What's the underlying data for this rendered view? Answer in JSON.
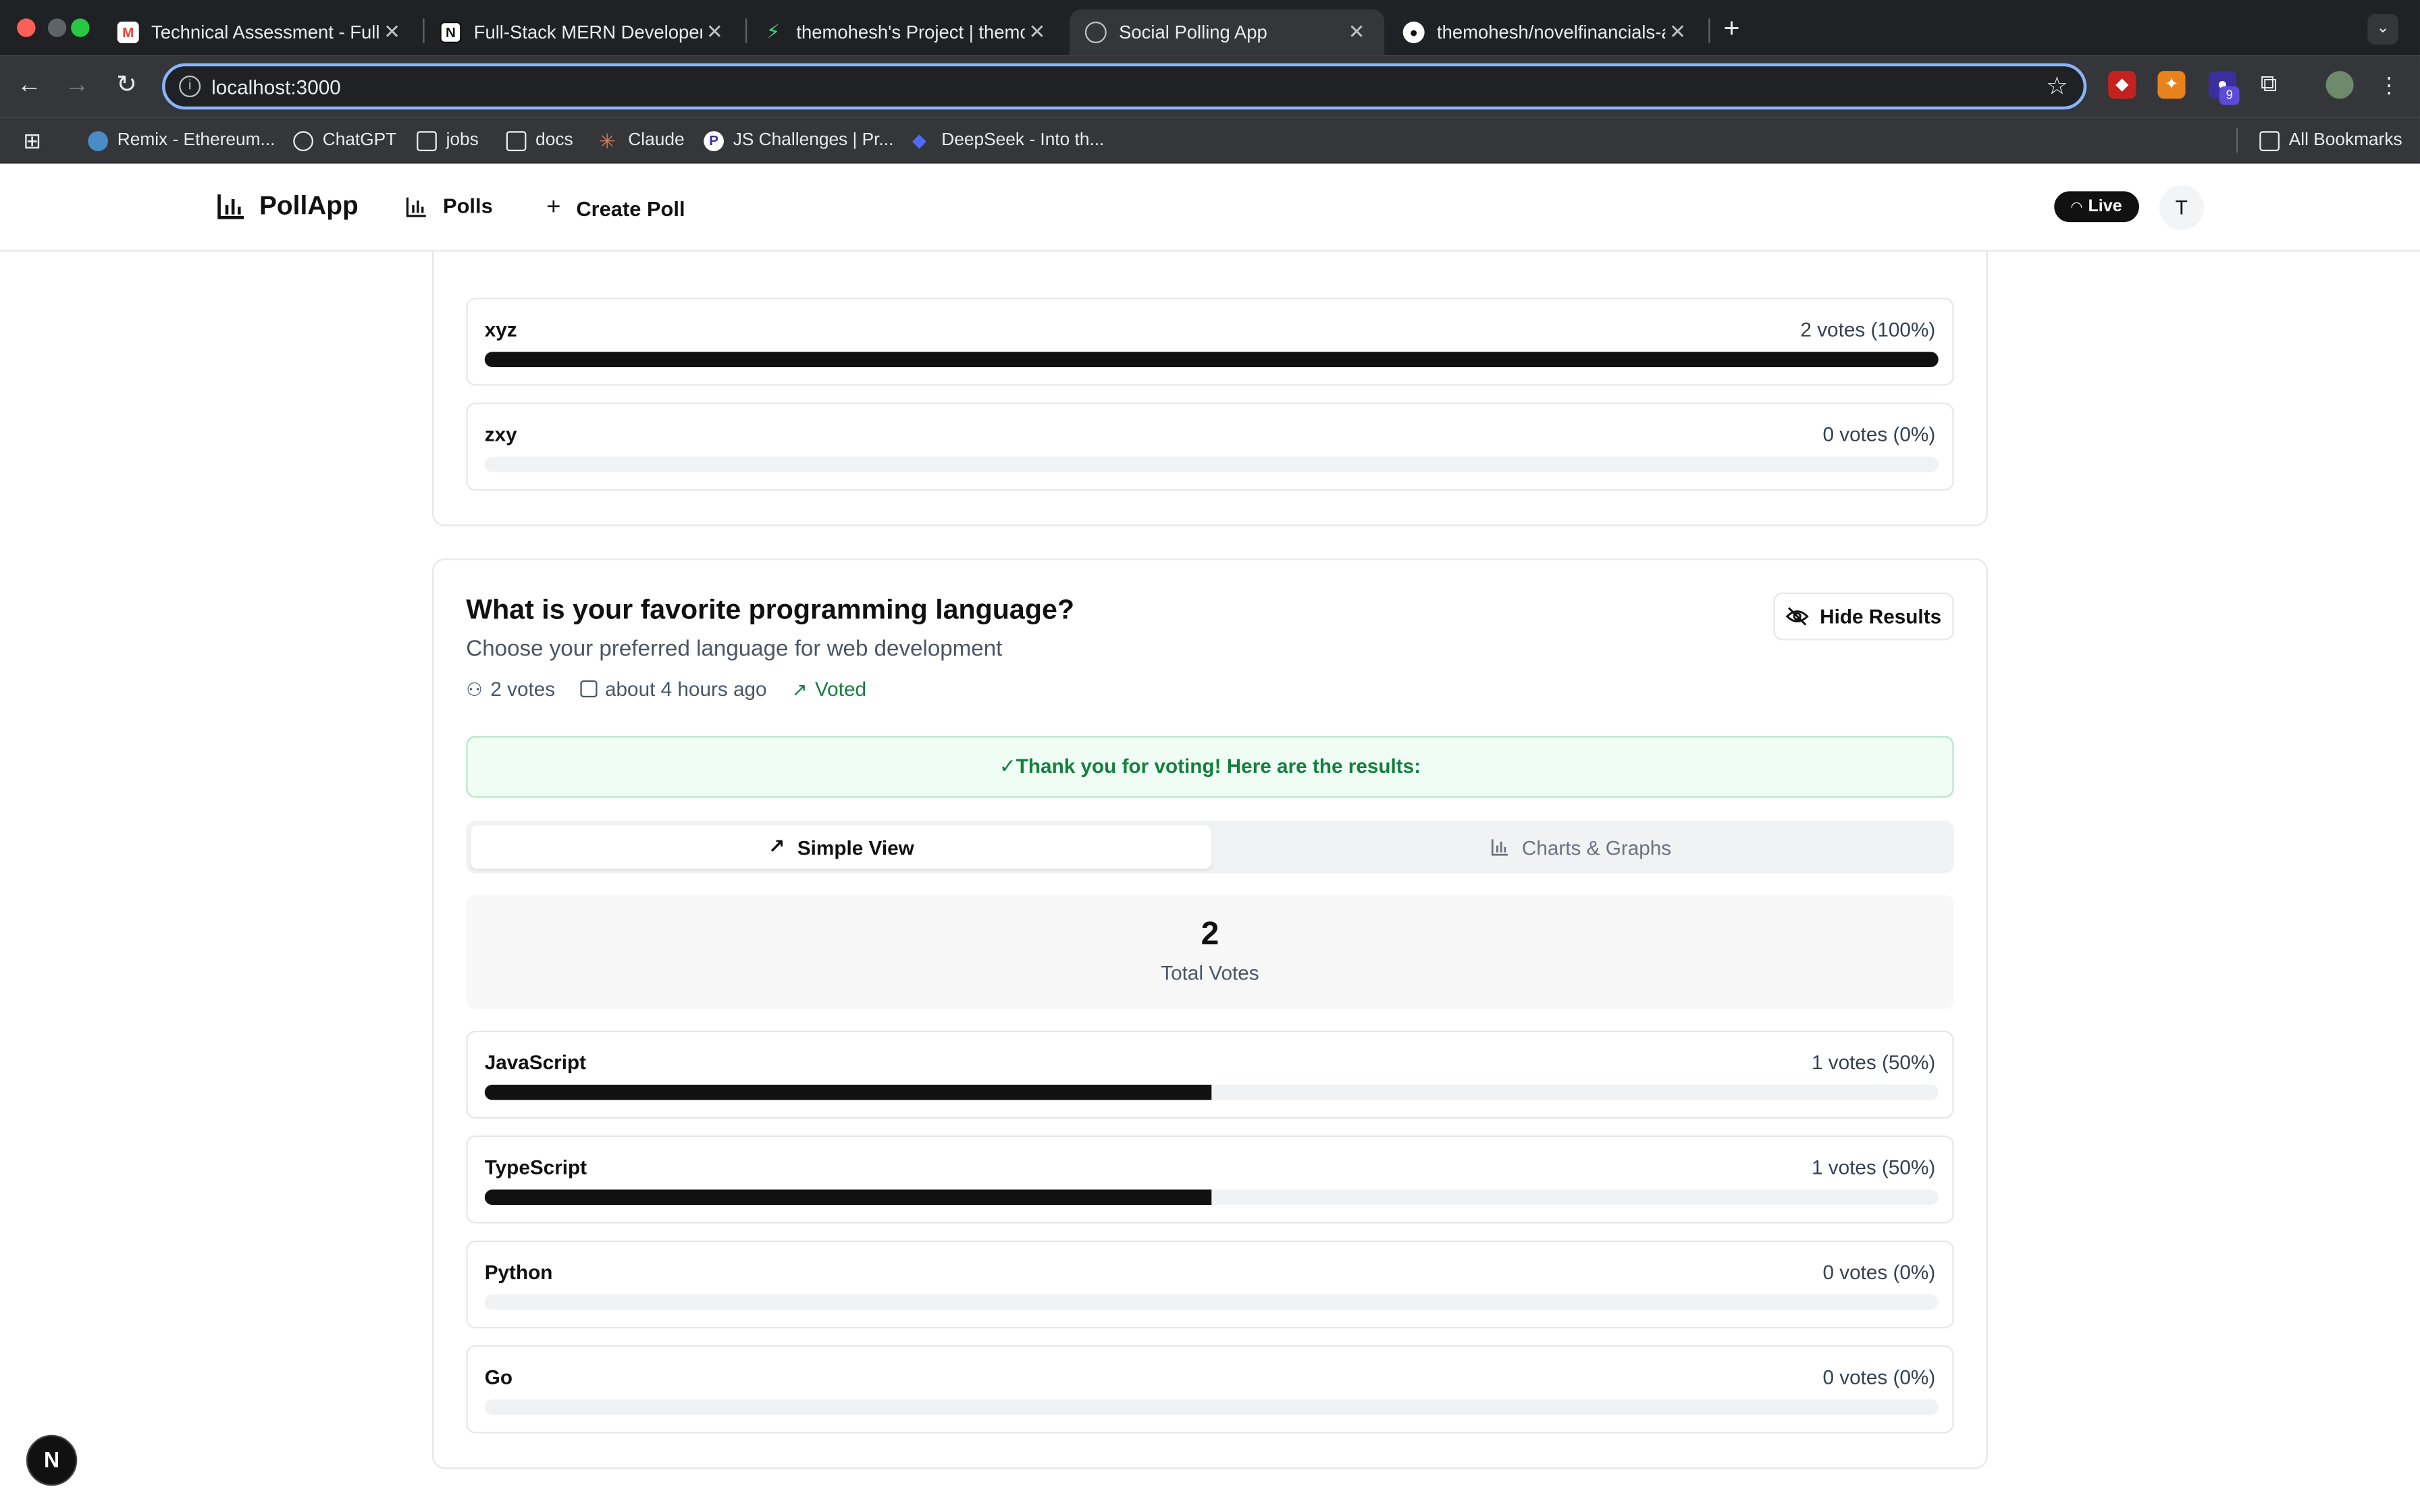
{
  "browser": {
    "tabs": [
      {
        "title": "Technical Assessment - Fullst",
        "icon": "gmail-icon"
      },
      {
        "title": "Full-Stack MERN Developer T",
        "icon": "notion-icon"
      },
      {
        "title": "themohesh's Project | themoh",
        "icon": "supabase-icon"
      },
      {
        "title": "Social Polling App",
        "icon": "globe-icon"
      },
      {
        "title": "themohesh/novelfinancials-a",
        "icon": "github-icon"
      }
    ],
    "url": "localhost:3000",
    "extension_badge": "9",
    "bookmarks": [
      {
        "label": "Remix - Ethereum...",
        "icon": "remix-icon"
      },
      {
        "label": "ChatGPT",
        "icon": "chatgpt-icon"
      },
      {
        "label": "jobs",
        "icon": "folder-icon"
      },
      {
        "label": "docs",
        "icon": "folder-icon"
      },
      {
        "label": "Claude",
        "icon": "claude-icon"
      },
      {
        "label": "JS Challenges | Pr...",
        "icon": "p-icon"
      },
      {
        "label": "DeepSeek - Into th...",
        "icon": "deepseek-icon"
      }
    ],
    "all_bookmarks": "All Bookmarks"
  },
  "header": {
    "brand": "PollApp",
    "nav": [
      {
        "label": "Polls",
        "icon": "bar-chart-icon"
      },
      {
        "label": "Create Poll",
        "icon": "plus-icon"
      }
    ],
    "live": "Live",
    "avatar": "T"
  },
  "prev_poll": {
    "options": [
      {
        "name": "xyz",
        "votes": "2 votes (100%)",
        "percent": 100
      },
      {
        "name": "zxy",
        "votes": "0 votes (0%)",
        "percent": 0
      }
    ]
  },
  "poll": {
    "title": "What is your favorite programming language?",
    "description": "Choose your preferred language for web development",
    "votes": "2 votes",
    "time": "about 4 hours ago",
    "status": "Voted",
    "hide_results": "Hide Results",
    "thanks": "✓Thank you for voting! Here are the results:",
    "tabs": [
      {
        "label": "Simple View",
        "icon": "trending-up-icon",
        "active": true
      },
      {
        "label": "Charts & Graphs",
        "icon": "bar-chart-icon",
        "active": false
      }
    ],
    "total_votes": "2",
    "total_label": "Total Votes",
    "options": [
      {
        "name": "JavaScript",
        "votes": "1 votes (50%)",
        "percent": 50
      },
      {
        "name": "TypeScript",
        "votes": "1 votes (50%)",
        "percent": 50
      },
      {
        "name": "Python",
        "votes": "0 votes (0%)",
        "percent": 0
      },
      {
        "name": "Go",
        "votes": "0 votes (0%)",
        "percent": 0
      }
    ]
  },
  "next_badge": "N",
  "colors": {
    "accent": "#111111",
    "success": "#15803d",
    "chrome": "#35363a",
    "focus": "#8ab4f8"
  }
}
